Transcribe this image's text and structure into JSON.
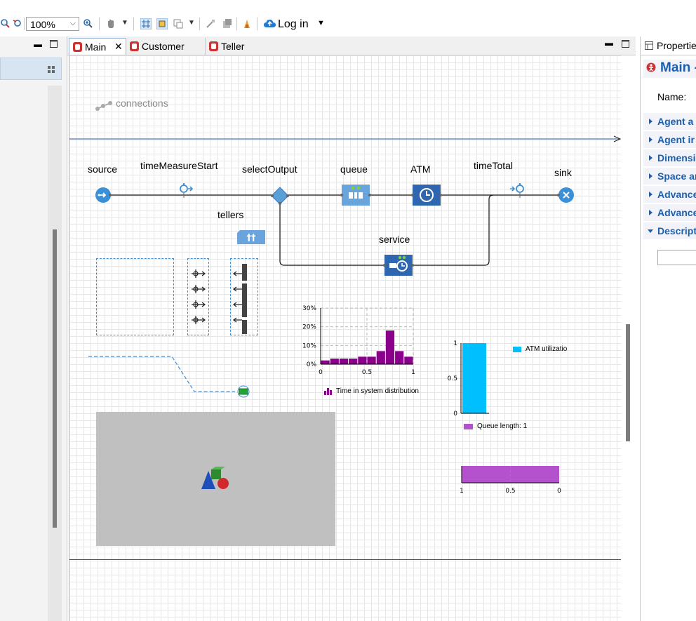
{
  "toolbar": {
    "zoom_value": "100%",
    "login_label": "Log in"
  },
  "tabs": [
    {
      "label": "Main"
    },
    {
      "label": "Customer"
    },
    {
      "label": "Teller"
    }
  ],
  "canvas": {
    "connections_label": "connections",
    "blocks": {
      "source": "source",
      "time_measure_start": "timeMeasureStart",
      "select_output": "selectOutput",
      "queue": "queue",
      "atm": "ATM",
      "time_total": "timeTotal",
      "sink": "sink",
      "tellers": "tellers",
      "service": "service"
    }
  },
  "histogram": {
    "legend": "Time in system distribution",
    "y_ticks": [
      "30%",
      "20%",
      "10%",
      "0%"
    ],
    "x_ticks": [
      "0",
      "0.5",
      "1"
    ],
    "color": "#8b008b"
  },
  "bar_chart": {
    "legend": "ATM utilizatio",
    "y_ticks": [
      "1",
      "0.5",
      "0"
    ],
    "color": "#00bfff"
  },
  "queue_chart": {
    "legend": "Queue length: 1",
    "x_ticks": [
      "1",
      "0.5",
      "0"
    ],
    "color": "#b452cd"
  },
  "properties": {
    "panel_title": "Propertie",
    "header": "Main -",
    "name_label": "Name:",
    "sections": [
      {
        "label": "Agent a"
      },
      {
        "label": "Agent ir"
      },
      {
        "label": "Dimensi"
      },
      {
        "label": "Space ar"
      },
      {
        "label": "Advance"
      },
      {
        "label": "Advance"
      },
      {
        "label": "Descript"
      }
    ]
  },
  "chart_data": [
    {
      "type": "bar",
      "title": "",
      "legend": [
        "Time in system distribution"
      ],
      "x": [
        0.0,
        0.1,
        0.2,
        0.3,
        0.4,
        0.5,
        0.6,
        0.7,
        0.8,
        0.9
      ],
      "values": [
        2,
        3,
        3,
        3,
        4,
        4,
        7,
        18,
        7,
        4
      ],
      "ylim": [
        0,
        30
      ],
      "xlim": [
        0,
        1
      ],
      "y_unit": "%"
    },
    {
      "type": "bar",
      "title": "",
      "legend": [
        "ATM utilizatio"
      ],
      "categories": [
        ""
      ],
      "values": [
        1
      ],
      "ylim": [
        0,
        1
      ]
    },
    {
      "type": "bar",
      "title": "",
      "legend": [
        "Queue length: 1"
      ],
      "categories": [
        ""
      ],
      "values": [
        1
      ],
      "xlim": [
        1,
        0
      ],
      "orientation": "horizontal"
    }
  ]
}
